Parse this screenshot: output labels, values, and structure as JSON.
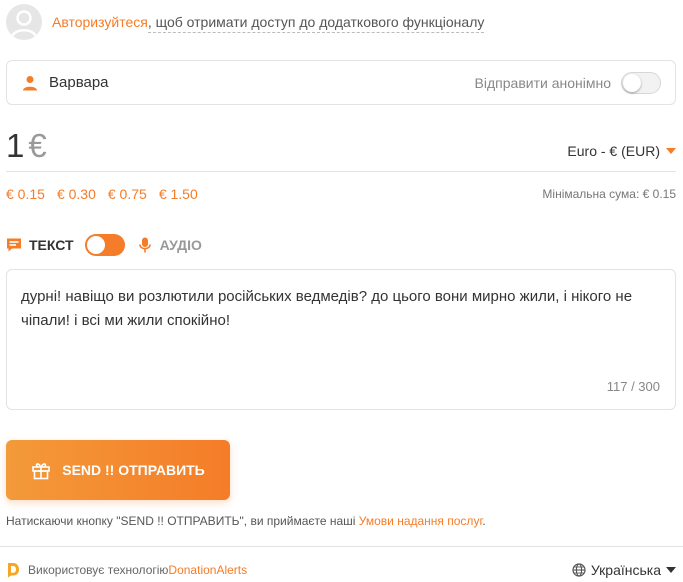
{
  "login": {
    "link": "Авторизуйтеся",
    "rest": ", щоб отримати доступ до додаткового функціоналу"
  },
  "name": {
    "value": "Варвара",
    "anonymous_label": "Відправити анонімно",
    "anonymous_enabled": false
  },
  "amount": {
    "value": "1",
    "currency_symbol": "€",
    "currency_select": "Euro - € (EUR)"
  },
  "presets": [
    "€ 0.15",
    "€ 0.30",
    "€ 0.75",
    "€ 1.50"
  ],
  "min_amount": "Мінімальна сума: € 0.15",
  "mode": {
    "text_label": "ТЕКСТ",
    "audio_label": "АУДІО",
    "toggle_state": "text"
  },
  "message": {
    "text": "дурні! навіщо ви розлютили російських ведмедів? до цього вони мирно жили, і нікого не чіпали! і всі ми жили спокійно!",
    "counter": "117 / 300"
  },
  "send": {
    "label": "SEND !! ОТПРАВИТЬ"
  },
  "terms": {
    "prefix": "Натискаючи кнопку \"SEND !! ОТПРАВИТЬ\", ви приймаєте наші ",
    "link": "Умови надання послуг",
    "suffix": "."
  },
  "footer": {
    "prefix": "Використовує технологію ",
    "link": "DonationAlerts",
    "language": "Українська"
  },
  "colors": {
    "accent": "#f57c28",
    "border": "#e3e3e3",
    "muted": "#888888"
  },
  "icons": {
    "avatar": "user-avatar-icon",
    "name": "user-icon",
    "text_mode": "chat-icon",
    "audio_mode": "microphone-icon",
    "send": "gift-icon",
    "footer_logo": "donationalerts-logo",
    "language": "globe-icon"
  }
}
